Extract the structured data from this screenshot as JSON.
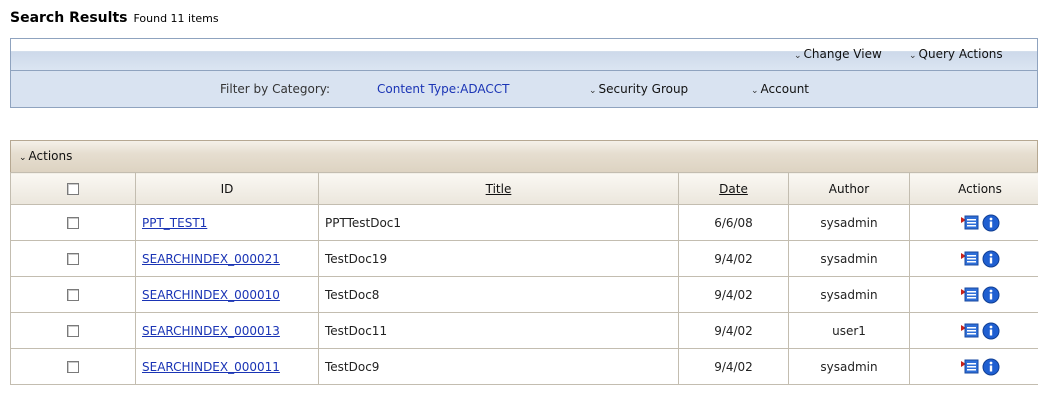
{
  "header": {
    "title": "Search Results",
    "count_text": "Found 11 items"
  },
  "toolbar": {
    "change_view": "Change View",
    "query_actions": "Query Actions"
  },
  "filter": {
    "label": "Filter by Category:",
    "content_type": "Content Type:ADACCT",
    "security_group": "Security Group",
    "account": "Account"
  },
  "actions_menu": {
    "label": "Actions"
  },
  "table": {
    "columns": {
      "id": "ID",
      "title": "Title",
      "date": "Date",
      "author": "Author",
      "actions": "Actions"
    },
    "rows": [
      {
        "id": "PPT_TEST1",
        "title": "PPTTestDoc1",
        "date": "6/6/08",
        "author": "sysadmin"
      },
      {
        "id": "SEARCHINDEX_000021",
        "title": "TestDoc19",
        "date": "9/4/02",
        "author": "sysadmin"
      },
      {
        "id": "SEARCHINDEX_000010",
        "title": "TestDoc8",
        "date": "9/4/02",
        "author": "sysadmin"
      },
      {
        "id": "SEARCHINDEX_000013",
        "title": "TestDoc11",
        "date": "9/4/02",
        "author": "user1"
      },
      {
        "id": "SEARCHINDEX_000011",
        "title": "TestDoc9",
        "date": "9/4/02",
        "author": "sysadmin"
      }
    ]
  },
  "icons": {
    "action_popup": "action-popup-icon",
    "info": "info-icon",
    "chevron": "chevron-down-icon"
  },
  "colors": {
    "link": "#1a34b5",
    "toolbar_blue": "#d9e3f1",
    "actions_bar": "#e6ded0",
    "info_blue": "#1f5fd1"
  }
}
